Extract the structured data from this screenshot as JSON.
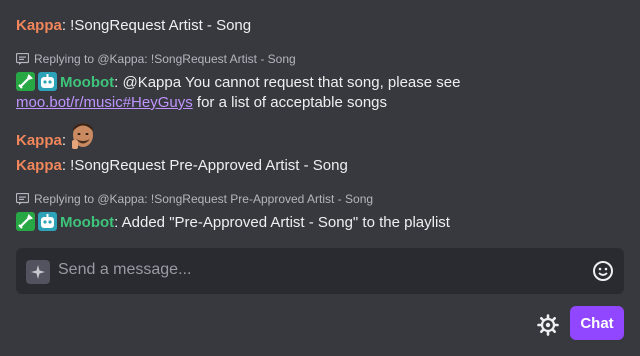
{
  "messages": [
    {
      "user": "Kappa",
      "colon": ":",
      "text": " !SongRequest Artist - Song"
    },
    {
      "reply": "Replying to @Kappa: !SongRequest Artist - Song",
      "user": "Moobot",
      "colon": ":",
      "text": " @Kappa You cannot request that song, please see",
      "link": "moo.bot/r/music#HeyGuys",
      "text2": " for a list of acceptable songs"
    },
    {
      "user": "Kappa",
      "colon": ":",
      "emote": "face-emote"
    },
    {
      "user": "Kappa",
      "colon": ":",
      "text": " !SongRequest Pre-Approved Artist - Song"
    },
    {
      "reply": "Replying to @Kappa: !SongRequest Pre-Approved Artist - Song",
      "user": "Moobot",
      "colon": ":",
      "text": " Added \"Pre-Approved Artist - Song\" to the playlist"
    }
  ],
  "input": {
    "placeholder": "Send a message..."
  },
  "buttons": {
    "chat_label": "Chat"
  },
  "icons": [
    "reply-icon",
    "moderator-badge-icon",
    "bot-badge-icon",
    "sparkle-icon",
    "emoji-icon",
    "settings-icon"
  ],
  "colors": {
    "kappa": "#f0865a",
    "moobot": "#3ec47a",
    "link": "#bf94ff",
    "chat_button": "#9147ff"
  }
}
